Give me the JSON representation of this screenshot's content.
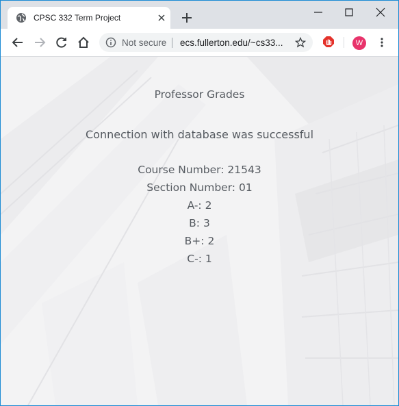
{
  "browser": {
    "tab_title": "CPSC 332 Term Project",
    "not_secure_label": "Not secure",
    "url": "ecs.fullerton.edu/~cs33...",
    "avatar_letter": "W"
  },
  "page": {
    "heading": "Professor Grades",
    "status": "Connection with database was successful",
    "course_line": "Course Number: 21543",
    "section_line": "Section Number: 01",
    "grades": [
      {
        "text": "A-: 2"
      },
      {
        "text": "B: 3"
      },
      {
        "text": "B+: 2"
      },
      {
        "text": "C-: 1"
      }
    ]
  },
  "colors": {
    "window_border": "#1a8ad4",
    "avatar": "#e8336b",
    "text": "#555a60"
  }
}
